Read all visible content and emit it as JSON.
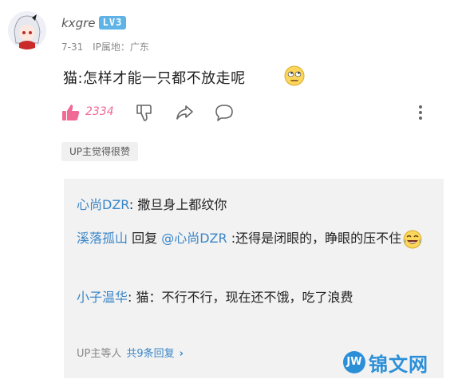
{
  "comment": {
    "username": "kxgre",
    "level": "LV3",
    "date": "7-31",
    "location": "IP属地：广东",
    "text": "猫:怎样才能一只都不放走呢",
    "likes": "2334",
    "up_badge": "UP主觉得很赞"
  },
  "icons": {
    "like": "thumbs-up-icon",
    "dislike": "thumbs-down-icon",
    "share": "share-icon",
    "reply": "comment-icon",
    "more": "more-vertical-icon"
  },
  "replies": [
    {
      "name": "心尚DZR",
      "sep": ":",
      "text": "撒旦身上都纹你"
    },
    {
      "name": "溪落孤山",
      "mid": " 回复 ",
      "at": "@心尚DZR",
      "sep": ":",
      "text": "还得是闭眼的，睁眼的压不住"
    },
    {
      "name": "小子温华",
      "sep": ":",
      "text": "猫：不行不行，现在还不饿，吃了浪费"
    }
  ],
  "more": {
    "label": "UP主等人",
    "count": "共9条回复"
  },
  "watermark": {
    "text": "锦文网"
  },
  "colors": {
    "accent_blue": "#3a86c8",
    "like_pink": "#f06a96",
    "level_badge": "#5fb3e6"
  }
}
